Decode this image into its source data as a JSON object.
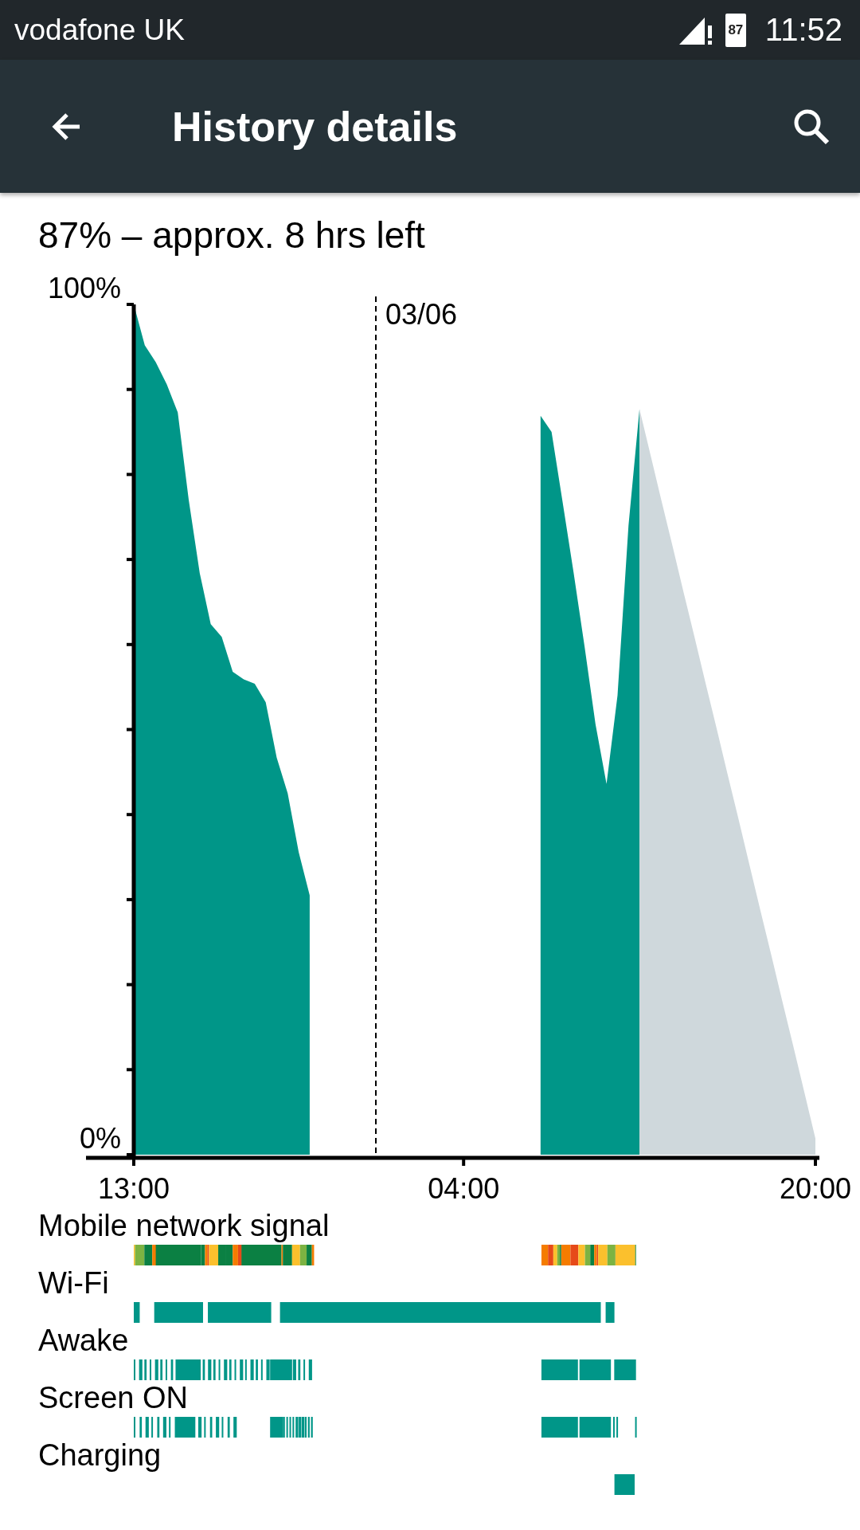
{
  "status_bar": {
    "carrier": "vodafone UK",
    "battery_text": "87",
    "time": "11:52"
  },
  "app_bar": {
    "title": "History details"
  },
  "summary": "87% – approx. 8 hrs left",
  "chart": {
    "chart_data": {
      "type": "area",
      "ylim": [
        0,
        100
      ],
      "categories": [
        "13:00",
        null,
        null,
        null,
        null,
        null,
        null,
        null,
        null,
        null,
        null,
        null,
        null,
        null,
        null,
        null,
        null,
        null,
        null,
        null,
        null,
        null,
        null,
        null,
        null,
        null,
        null,
        null,
        null,
        null,
        "04:00",
        null,
        null,
        null,
        null,
        null,
        null,
        null,
        null,
        null,
        null,
        null,
        null,
        null,
        null,
        null,
        null,
        null,
        null,
        null,
        null,
        null,
        null,
        null,
        null,
        null,
        null,
        null,
        null,
        null,
        null,
        null,
        "20:00"
      ],
      "series": [
        {
          "color": "#009688",
          "values": [
            100,
            95.2,
            93.2,
            90.6,
            87.3,
            77,
            68.4,
            62.4,
            60.9,
            56.8,
            55.9,
            55.4,
            53.2,
            46.7,
            42.5,
            35.6,
            30.5,
            null,
            null,
            null,
            null,
            null,
            null,
            null,
            null,
            null,
            null,
            null,
            null,
            null,
            null,
            null,
            null,
            null,
            null,
            null,
            null,
            null,
            null,
            null,
            null,
            null,
            null,
            null,
            null,
            null,
            null,
            null,
            null,
            null,
            null,
            null,
            null,
            null,
            null,
            null,
            null,
            null,
            null,
            null,
            null,
            null,
            null
          ]
        },
        {
          "color": "#009688",
          "values": [
            null,
            null,
            null,
            null,
            null,
            null,
            null,
            null,
            null,
            null,
            null,
            null,
            null,
            null,
            null,
            null,
            null,
            null,
            null,
            null,
            null,
            null,
            null,
            null,
            null,
            null,
            null,
            null,
            null,
            null,
            null,
            null,
            null,
            null,
            null,
            null,
            null,
            86.9,
            85,
            76.8,
            68.5,
            59.8,
            50.6,
            43.6,
            54,
            74,
            87.7,
            null,
            null,
            null,
            null,
            null,
            null,
            null,
            null,
            null,
            null,
            null,
            null,
            null,
            null,
            null,
            null
          ]
        },
        {
          "color": "#cfd8dc",
          "values": [
            null,
            null,
            null,
            null,
            null,
            null,
            null,
            null,
            null,
            null,
            null,
            null,
            null,
            null,
            null,
            null,
            null,
            null,
            null,
            null,
            null,
            null,
            null,
            null,
            null,
            null,
            null,
            null,
            null,
            null,
            null,
            null,
            null,
            null,
            null,
            null,
            null,
            null,
            null,
            null,
            null,
            null,
            null,
            null,
            null,
            null,
            87.7,
            82.3,
            76.9,
            71.6,
            66.2,
            60.9,
            55.5,
            50.2,
            44.8,
            39.5,
            34.1,
            28.7,
            23.4,
            18,
            12.7,
            7.3,
            1.9
          ]
        }
      ],
      "yticks": [
        {
          "value": 0,
          "label": "0%"
        },
        {
          "value": 100,
          "label": "100%"
        }
      ],
      "annotations": [
        "03/06"
      ]
    }
  },
  "strips": [
    {
      "label": "Mobile network signal",
      "kind": "signal"
    },
    {
      "label": "Wi-Fi",
      "kind": "state"
    },
    {
      "label": "Awake",
      "kind": "state"
    },
    {
      "label": "Screen ON",
      "kind": "state"
    },
    {
      "label": "Charging",
      "kind": "state"
    }
  ]
}
